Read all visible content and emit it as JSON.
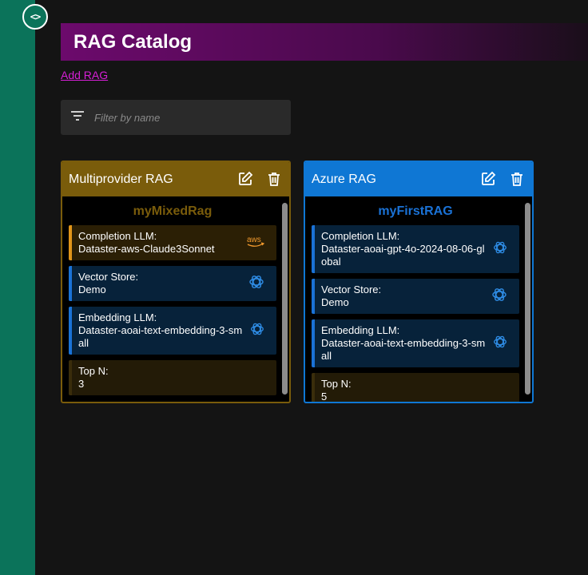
{
  "app": {
    "logo_icon": "code-brackets-icon",
    "logo_text": "<>",
    "accent": "#0b735a"
  },
  "header": {
    "title": "RAG Catalog"
  },
  "actions": {
    "add_label": "Add RAG"
  },
  "filter": {
    "placeholder": "Filter by name",
    "icon": "filter-icon"
  },
  "cards": [
    {
      "title": "Multiprovider RAG",
      "name": "myMixedRag",
      "color": "#7a5c0b",
      "items": [
        {
          "label": "Completion LLM:",
          "value": "Dataster-aws-Claude3Sonnet",
          "icon": "aws-icon"
        },
        {
          "label": "Vector Store:",
          "value": "Demo",
          "icon": "openai-icon"
        },
        {
          "label": "Embedding LLM:",
          "value": "Dataster-aoai-text-embedding-3-small",
          "icon": "openai-icon"
        },
        {
          "label": "Top N:",
          "value": "3"
        }
      ]
    },
    {
      "title": "Azure RAG",
      "name": "myFirstRAG",
      "color": "#0f77d4",
      "items": [
        {
          "label": "Completion LLM:",
          "value": "Dataster-aoai-gpt-4o-2024-08-06-global",
          "icon": "openai-icon"
        },
        {
          "label": "Vector Store:",
          "value": "Demo",
          "icon": "openai-icon"
        },
        {
          "label": "Embedding LLM:",
          "value": "Dataster-aoai-text-embedding-3-small",
          "icon": "openai-icon"
        },
        {
          "label": "Top N:",
          "value": "5"
        }
      ]
    }
  ]
}
